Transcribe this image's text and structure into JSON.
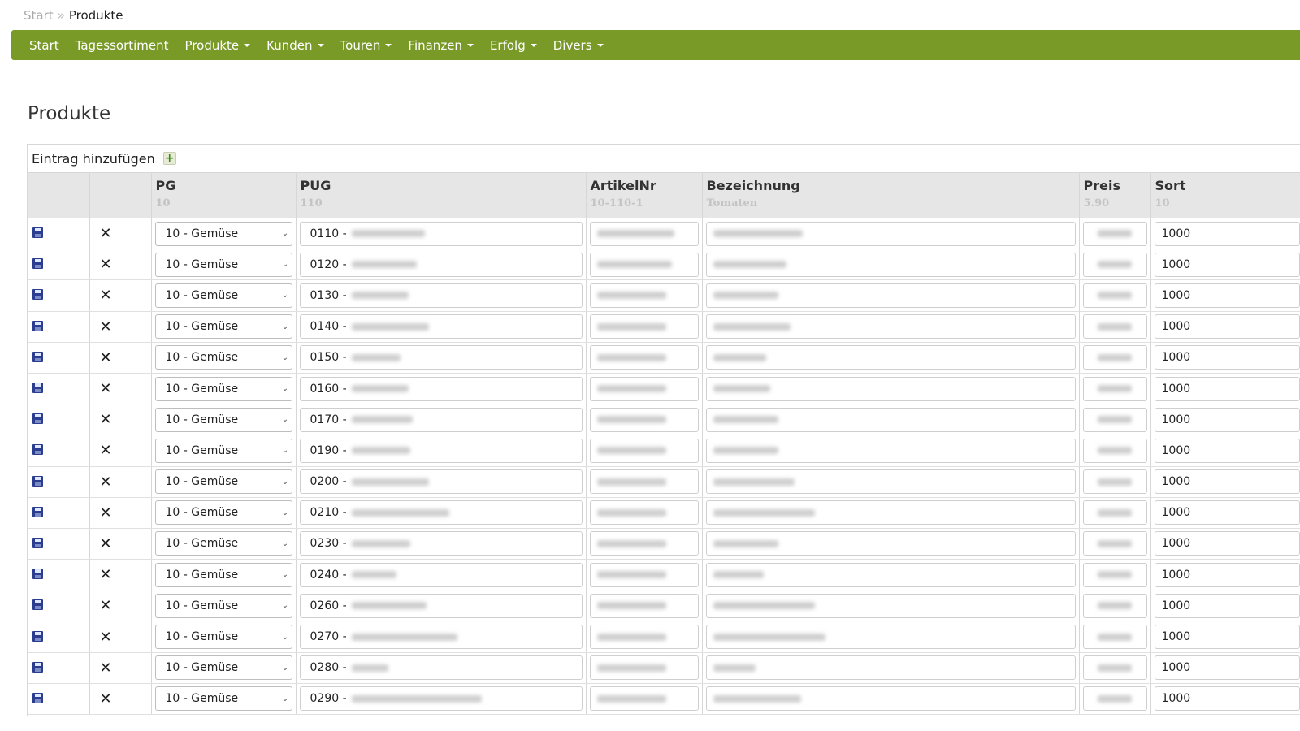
{
  "breadcrumb": {
    "home": "Start",
    "separator": "»",
    "current": "Produkte"
  },
  "nav": [
    {
      "label": "Start",
      "dropdown": false
    },
    {
      "label": "Tagessortiment",
      "dropdown": false
    },
    {
      "label": "Produkte",
      "dropdown": true
    },
    {
      "label": "Kunden",
      "dropdown": true
    },
    {
      "label": "Touren",
      "dropdown": true
    },
    {
      "label": "Finanzen",
      "dropdown": true
    },
    {
      "label": "Erfolg",
      "dropdown": true
    },
    {
      "label": "Divers",
      "dropdown": true
    }
  ],
  "colors": {
    "navbar": "#7a9a28",
    "header_bg": "#e6e6e6",
    "save_icon": "#2a3d8f"
  },
  "page_title": "Produkte",
  "add_entry": {
    "label": "Eintrag hinzufügen",
    "icon": "add-icon"
  },
  "columns": [
    {
      "title": "",
      "hint": ""
    },
    {
      "title": "",
      "hint": ""
    },
    {
      "title": "PG",
      "hint": "10"
    },
    {
      "title": "PUG",
      "hint": "110"
    },
    {
      "title": "ArtikelNr",
      "hint": "10-110-1"
    },
    {
      "title": "Bezeichnung",
      "hint": "Tomaten"
    },
    {
      "title": "Preis",
      "hint": "5.90"
    },
    {
      "title": "Sort",
      "hint": "10"
    }
  ],
  "rows": [
    {
      "pg": "10 - Gemüse",
      "pug": "0110 -",
      "sort": "1000"
    },
    {
      "pg": "10 - Gemüse",
      "pug": "0120 -",
      "sort": "1000"
    },
    {
      "pg": "10 - Gemüse",
      "pug": "0130 -",
      "sort": "1000"
    },
    {
      "pg": "10 - Gemüse",
      "pug": "0140 -",
      "sort": "1000"
    },
    {
      "pg": "10 - Gemüse",
      "pug": "0150 -",
      "sort": "1000"
    },
    {
      "pg": "10 - Gemüse",
      "pug": "0160 -",
      "sort": "1000"
    },
    {
      "pg": "10 - Gemüse",
      "pug": "0170 -",
      "sort": "1000"
    },
    {
      "pg": "10 - Gemüse",
      "pug": "0190 -",
      "sort": "1000"
    },
    {
      "pg": "10 - Gemüse",
      "pug": "0200 -",
      "sort": "1000"
    },
    {
      "pg": "10 - Gemüse",
      "pug": "0210 -",
      "sort": "1000"
    },
    {
      "pg": "10 - Gemüse",
      "pug": "0230 -",
      "sort": "1000"
    },
    {
      "pg": "10 - Gemüse",
      "pug": "0240 -",
      "sort": "1000"
    },
    {
      "pg": "10 - Gemüse",
      "pug": "0260 -",
      "sort": "1000"
    },
    {
      "pg": "10 - Gemüse",
      "pug": "0270 -",
      "sort": "1000"
    },
    {
      "pg": "10 - Gemüse",
      "pug": "0280 -",
      "sort": "1000"
    },
    {
      "pg": "10 - Gemüse",
      "pug": "0290 -",
      "sort": "1000"
    }
  ]
}
